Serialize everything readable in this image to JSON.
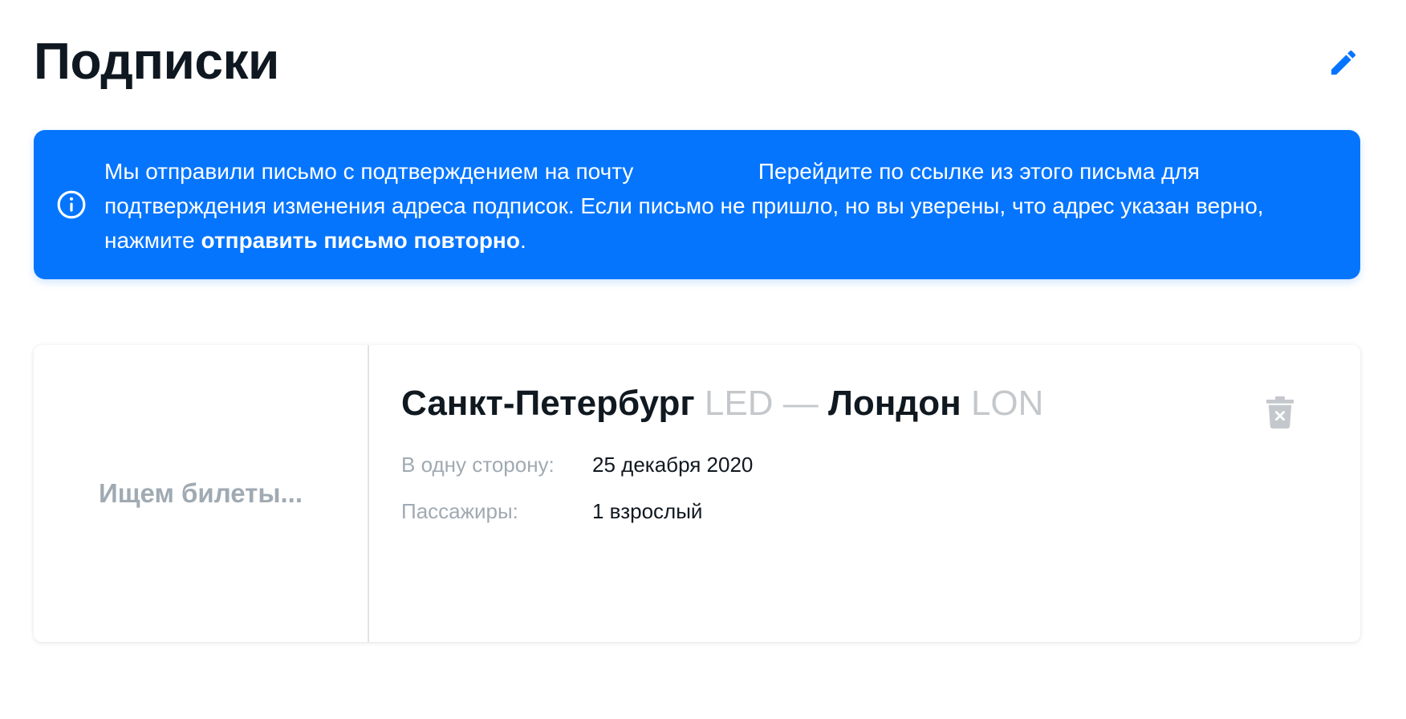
{
  "header": {
    "title": "Подписки",
    "edit_icon": "pencil-icon"
  },
  "notice": {
    "icon": "info-circle-icon",
    "text_before_email": "Мы отправили письмо с подтверждением на почту",
    "email": "",
    "text_after_email": "Перейдите по ссылке из этого письма для подтверждения изменения адреса подписок. Если письмо не пришло, но вы уверены, что адрес указан верно, нажмите",
    "resend_link": "отправить письмо повторно",
    "text_end": "."
  },
  "subscription": {
    "status": "Ищем билеты...",
    "origin_city": "Санкт-Петербург",
    "origin_code": "LED",
    "separator": "—",
    "destination_city": "Лондон",
    "destination_code": "LON",
    "trip_label": "В одну сторону:",
    "trip_value": "25 декабря 2020",
    "passengers_label": "Пассажиры:",
    "passengers_value": "1 взрослый",
    "delete_icon": "trash-icon"
  },
  "colors": {
    "accent": "#0575fe",
    "muted": "#a0aab2",
    "code": "#c4c8cc"
  }
}
